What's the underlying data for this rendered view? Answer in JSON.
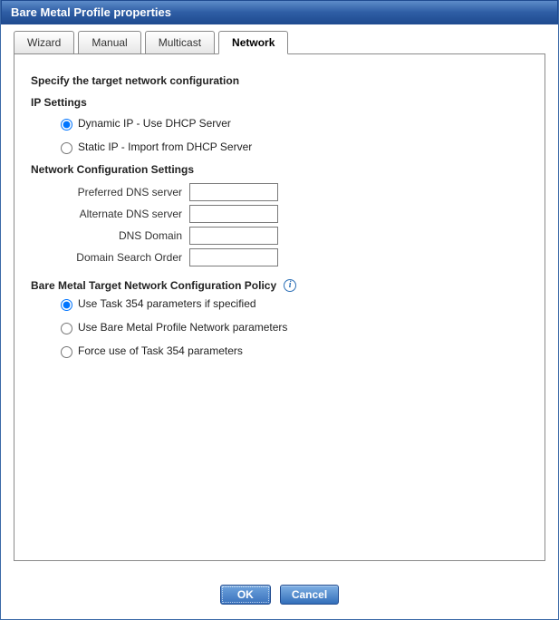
{
  "title": "Bare Metal Profile properties",
  "tabs": [
    {
      "label": "Wizard",
      "active": false
    },
    {
      "label": "Manual",
      "active": false
    },
    {
      "label": "Multicast",
      "active": false
    },
    {
      "label": "Network",
      "active": true
    }
  ],
  "section_heading": "Specify the target network configuration",
  "ip_settings": {
    "title": "IP Settings",
    "options": [
      {
        "label": "Dynamic IP - Use DHCP Server",
        "selected": true
      },
      {
        "label": "Static IP - Import from DHCP Server",
        "selected": false
      }
    ]
  },
  "net_cfg": {
    "title": "Network Configuration Settings",
    "fields": [
      {
        "label": "Preferred DNS server",
        "value": ""
      },
      {
        "label": "Alternate DNS server",
        "value": ""
      },
      {
        "label": "DNS Domain",
        "value": ""
      },
      {
        "label": "Domain Search Order",
        "value": ""
      }
    ]
  },
  "policy": {
    "title": "Bare Metal Target Network Configuration Policy",
    "options": [
      {
        "label": "Use Task 354 parameters if specified",
        "selected": true
      },
      {
        "label": "Use Bare Metal Profile Network parameters",
        "selected": false
      },
      {
        "label": "Force use of Task 354 parameters",
        "selected": false
      }
    ]
  },
  "buttons": {
    "ok": "OK",
    "cancel": "Cancel"
  }
}
